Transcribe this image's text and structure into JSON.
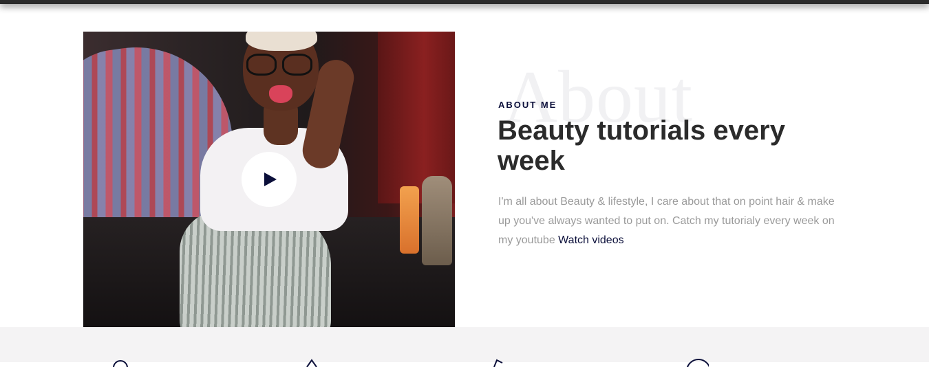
{
  "about": {
    "background_word": "About",
    "eyebrow": "ABOUT ME",
    "heading": "Beauty tutorials every week",
    "body": "I'm all about Beauty & lifestyle, I care about that on point hair & make up you've always wanted to put on. Catch my tutorialy every week on my youtube ",
    "link_label": "Watch videos"
  },
  "icons": {
    "play": "play-icon",
    "features": [
      "user-icon",
      "drop-icon",
      "pen-icon",
      "circle-icon"
    ]
  },
  "colors": {
    "accent_navy": "#0b0f3a",
    "heading": "#2b2b2b",
    "body_text": "#9a9a9a",
    "band_background": "#f4f3f4"
  }
}
